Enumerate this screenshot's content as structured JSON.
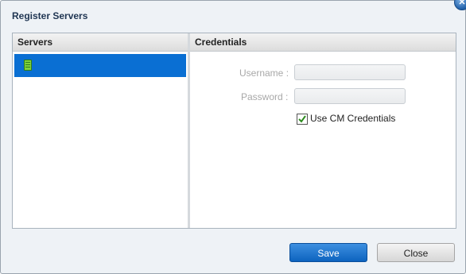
{
  "dialog": {
    "title": "Register Servers",
    "close_icon": "close-x-icon"
  },
  "servers": {
    "header": "Servers",
    "items": [
      {
        "icon": "server-icon",
        "selected": true
      }
    ]
  },
  "credentials": {
    "header": "Credentials",
    "username_label": "Username :",
    "username_value": "",
    "password_label": "Password :",
    "password_value": "",
    "use_cm_label": "Use CM Credentials",
    "use_cm_checked": true
  },
  "buttons": {
    "save": "Save",
    "close": "Close"
  },
  "colors": {
    "accent": "#0a6fd3",
    "dialog_bg": "#eef2f6"
  }
}
